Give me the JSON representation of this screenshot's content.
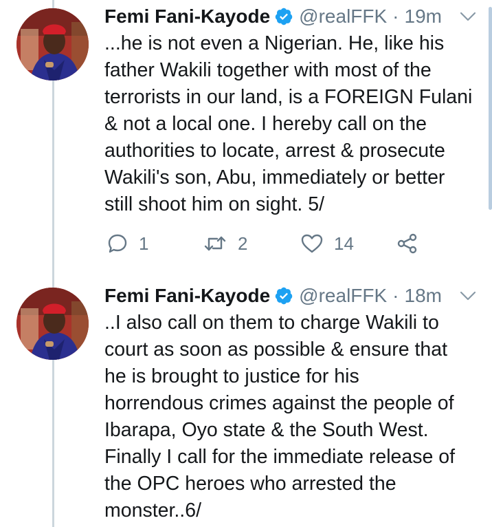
{
  "colors": {
    "verified": "#1da1f2",
    "meta_gray": "#657786",
    "thread_line": "#ccd6dd",
    "text": "#14171a"
  },
  "tweets": [
    {
      "name": "Femi Fani-Kayode",
      "handle": "@realFFK",
      "separator": "·",
      "time": "19m",
      "text": "...he is not even a Nigerian. He, like his\nfather Wakili together with most of the\nterrorists in our land, is a FOREIGN Fulani\n& not a local one. I hereby call on the\nauthorities to locate, arrest & prosecute\nWakili's son, Abu, immediately or better\nstill shoot him on sight. 5/",
      "replies": "1",
      "retweets": "2",
      "likes": "14"
    },
    {
      "name": "Femi Fani-Kayode",
      "handle": "@realFFK",
      "separator": "·",
      "time": "18m",
      "text": "..I also call on them to charge Wakili to\ncourt as soon as possible & ensure that\nhe is brought to justice for his\nhorrendous crimes against the people of\nIbarapa, Oyo state & the South West.\nFinally I call for the immediate release of\nthe OPC heroes who arrested the\nmonster..6/"
    }
  ],
  "icons": {
    "verified": "verified-badge-icon",
    "chevron": "chevron-down-icon",
    "reply": "reply-icon",
    "retweet": "retweet-icon",
    "like": "heart-icon",
    "share": "share-icon"
  }
}
